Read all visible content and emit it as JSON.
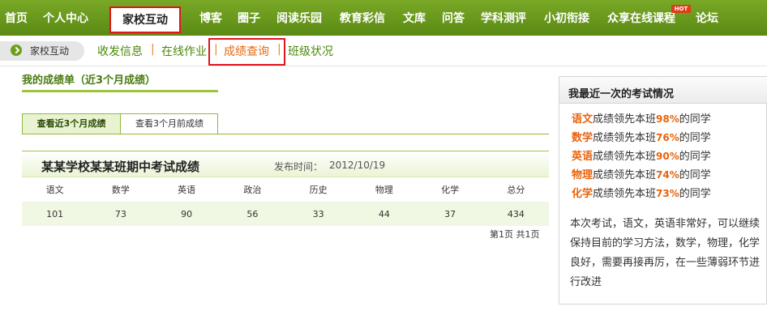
{
  "topnav": {
    "items": [
      "首页",
      "个人中心",
      "家校互动",
      "博客",
      "圈子",
      "阅读乐园",
      "教育彩信",
      "文库",
      "问答",
      "学科测评",
      "小初衔接",
      "众享在线课程",
      "论坛"
    ],
    "hot_badge": "HOT"
  },
  "subnav": {
    "breadcrumb": "家校互动",
    "links": [
      "收发信息",
      "在线作业",
      "成绩查询",
      "班级状况"
    ],
    "separator": "|"
  },
  "main": {
    "title": "我的成绩单（近3个月成绩）",
    "tabs": [
      "查看近3个月成绩",
      "查看3个月前成绩"
    ],
    "exam": {
      "title": "某某学校某某班期中考试成绩",
      "publish_label": "发布时间：",
      "publish_date": "2012/10/19",
      "headers": [
        "语文",
        "数学",
        "英语",
        "政治",
        "历史",
        "物理",
        "化学",
        "总分"
      ],
      "scores": [
        "101",
        "73",
        "90",
        "56",
        "33",
        "44",
        "37",
        "434"
      ]
    },
    "pager": "第1页  共1页"
  },
  "sidebar": {
    "title": "我最近一次的考试情况",
    "rankings": [
      {
        "subject": "语文",
        "pre": "成绩领先本班",
        "percent": "98%",
        "post": "的同学"
      },
      {
        "subject": "数学",
        "pre": "成绩领先本班",
        "percent": "76%",
        "post": "的同学"
      },
      {
        "subject": "英语",
        "pre": "成绩领先本班",
        "percent": "90%",
        "post": "的同学"
      },
      {
        "subject": "物理",
        "pre": "成绩领先本班",
        "percent": "74%",
        "post": "的同学"
      },
      {
        "subject": "化学",
        "pre": "成绩领先本班",
        "percent": "73%",
        "post": "的同学"
      }
    ],
    "comment": "本次考试，语文，英语非常好，可以继续保持目前的学习方法，数学，物理，化学良好，需要再接再厉，在一些薄弱环节进行改进"
  },
  "colors": {
    "nav_green": "#6a9a1c",
    "link_green": "#4a8a0a",
    "highlight_red": "#e0161b",
    "accent_orange": "#e8620c"
  }
}
